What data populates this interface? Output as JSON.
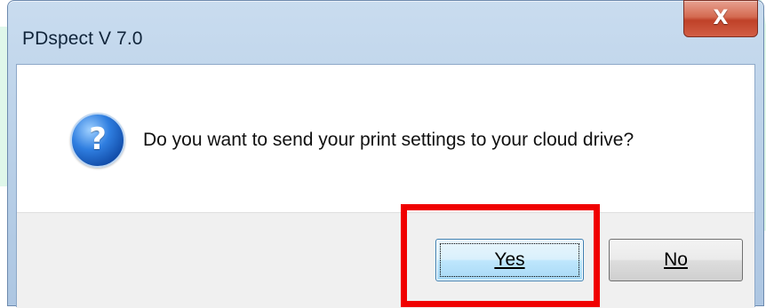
{
  "window": {
    "title": "PDspect V 7.0",
    "close_glyph": "X",
    "close_icon": "close-icon"
  },
  "dialog": {
    "icon": "question-icon",
    "icon_glyph": "?",
    "message": "Do you want to send your print settings to your cloud drive?"
  },
  "buttons": {
    "yes_label": "Yes",
    "no_label": "No",
    "focused": "Yes"
  },
  "annotation": {
    "highlight_color": "#f00000",
    "highlight_target": "Yes"
  }
}
